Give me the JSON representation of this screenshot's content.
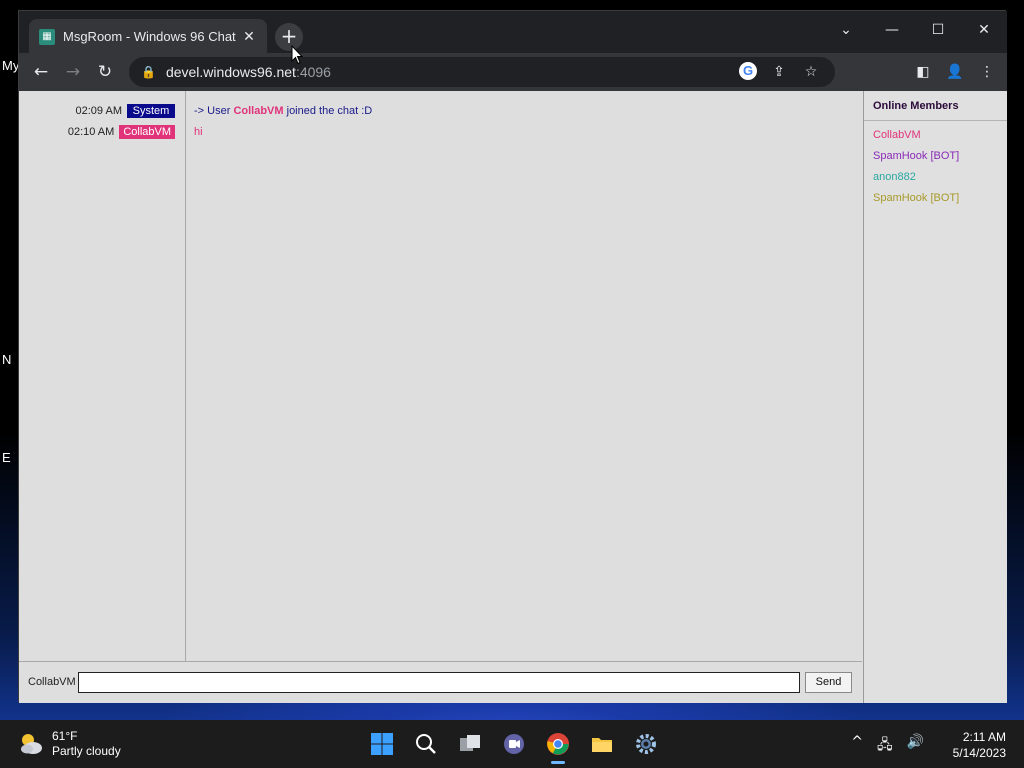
{
  "desktop": {
    "icon_labels": [
      "My",
      "N",
      "E"
    ]
  },
  "browser": {
    "tab": {
      "title": "MsgRoom - Windows 96 Chat",
      "close_glyph": "✕"
    },
    "new_tab_glyph": "+",
    "window_controls": {
      "tabsearch": "⌄",
      "minimize": "—",
      "maximize": "☐",
      "close": "✕"
    },
    "nav": {
      "back": "←",
      "forward": "→",
      "reload": "↻"
    },
    "address": {
      "host": "devel.windows96.net",
      "port": ":4096",
      "lock": "🔒"
    },
    "omnibox_icons": {
      "google": "G",
      "share": "⇪",
      "bookmark": "☆"
    },
    "toolbar_icons": {
      "side_panel": "◧",
      "profile": "👤",
      "menu": "⋮"
    }
  },
  "chat": {
    "timestamps": [
      {
        "time": "02:09 AM",
        "user": "System",
        "color": "#0a0a8c"
      },
      {
        "time": "02:10 AM",
        "user": "CollabVM",
        "color": "#e0337a"
      }
    ],
    "messages": [
      {
        "prefix": "-> User ",
        "user": "CollabVM",
        "suffix": " joined the chat :D",
        "color": "#1a1a8a",
        "user_color": "#e0337a"
      },
      {
        "text": "hi",
        "color": "#e0337a"
      }
    ],
    "members_header": "Online Members",
    "members": [
      {
        "name": "CollabVM",
        "color": "#e0337a"
      },
      {
        "name": "SpamHook [BOT]",
        "color": "#8a2ab8"
      },
      {
        "name": "anon882",
        "color": "#2aa8a0"
      },
      {
        "name": "SpamHook [BOT]",
        "color": "#a89a2a"
      }
    ],
    "input_label": "CollabVM",
    "input_value": "",
    "send_label": "Send"
  },
  "taskbar": {
    "weather": {
      "temp": "61°F",
      "condition": "Partly cloudy"
    },
    "apps": [
      "start-icon",
      "search-icon",
      "task-view-icon",
      "teams-chat-icon",
      "chrome-icon",
      "file-explorer-icon",
      "settings-icon"
    ],
    "tray": {
      "chevron": "^",
      "network": "🖧",
      "volume": "🔊"
    },
    "clock": {
      "time": "2:11 AM",
      "date": "5/14/2023"
    }
  }
}
